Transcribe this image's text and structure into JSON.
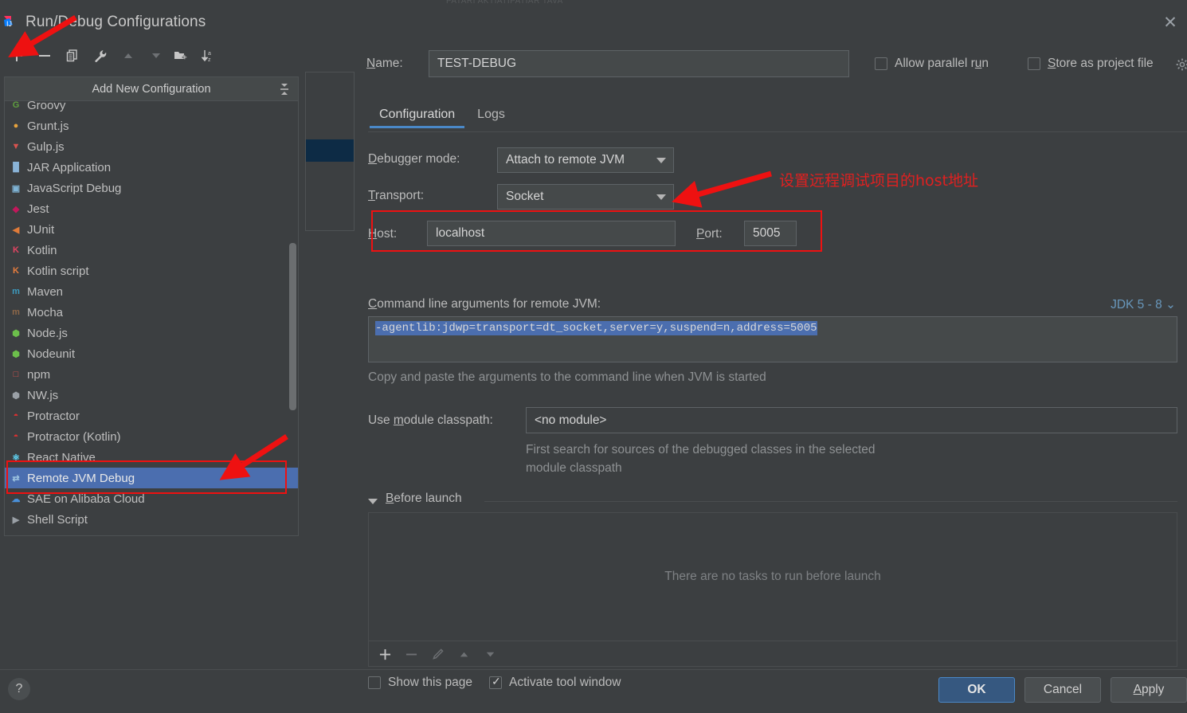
{
  "window": {
    "title": "Run/Debug Configurations",
    "app_icon": "intellij-icon",
    "close_icon": "close-icon"
  },
  "toolbar": {
    "buttons": [
      {
        "name": "add-configuration-button",
        "glyph": "+",
        "enabled": true
      },
      {
        "name": "remove-configuration-button",
        "glyph": "−",
        "enabled": true
      },
      {
        "name": "copy-configuration-button",
        "glyph": "copy-icon",
        "enabled": true
      },
      {
        "name": "edit-templates-button",
        "glyph": "wrench-icon",
        "enabled": true
      },
      {
        "name": "move-up-button",
        "glyph": "triangle-up-icon",
        "enabled": false
      },
      {
        "name": "move-down-button",
        "glyph": "triangle-down-icon",
        "enabled": false
      },
      {
        "name": "new-folder-button",
        "glyph": "folder-add-icon",
        "enabled": true
      },
      {
        "name": "sort-alphabetically-button",
        "glyph": "sort-az-icon",
        "enabled": true
      }
    ]
  },
  "left_panel": {
    "header": "Add New Configuration",
    "collapse_icon": "collapse-all-icon",
    "items": [
      {
        "label": "Groovy",
        "icon": "groovy-icon",
        "icon_text": "G",
        "icon_color": "#5f9e3f",
        "selected": false,
        "clipped": true
      },
      {
        "label": "Grunt.js",
        "icon": "grunt-icon",
        "icon_text": "●",
        "icon_color": "#e8a33d",
        "selected": false
      },
      {
        "label": "Gulp.js",
        "icon": "gulp-icon",
        "icon_text": "▼",
        "icon_color": "#d9534f",
        "selected": false
      },
      {
        "label": "JAR Application",
        "icon": "jar-icon",
        "icon_text": "█",
        "icon_color": "#8ab4d8",
        "selected": false
      },
      {
        "label": "JavaScript Debug",
        "icon": "javascript-debug-icon",
        "icon_text": "▣",
        "icon_color": "#7fb3d5",
        "selected": false
      },
      {
        "label": "Jest",
        "icon": "jest-icon",
        "icon_text": "◆",
        "icon_color": "#c2185b",
        "selected": false
      },
      {
        "label": "JUnit",
        "icon": "junit-icon",
        "icon_text": "◀",
        "icon_color": "#e07b39",
        "selected": false
      },
      {
        "label": "Kotlin",
        "icon": "kotlin-icon",
        "icon_text": "K",
        "icon_color": "#e24462",
        "selected": false
      },
      {
        "label": "Kotlin script",
        "icon": "kotlin-script-icon",
        "icon_text": "K",
        "icon_color": "#e87d3e",
        "selected": false
      },
      {
        "label": "Maven",
        "icon": "maven-icon",
        "icon_text": "m",
        "icon_color": "#3d9bbf",
        "selected": false
      },
      {
        "label": "Mocha",
        "icon": "mocha-icon",
        "icon_text": "m",
        "icon_color": "#8d6748",
        "selected": false
      },
      {
        "label": "Node.js",
        "icon": "nodejs-icon",
        "icon_text": "⬢",
        "icon_color": "#6cbf4b",
        "selected": false
      },
      {
        "label": "Nodeunit",
        "icon": "nodeunit-icon",
        "icon_text": "⬢",
        "icon_color": "#6cbf4b",
        "selected": false
      },
      {
        "label": "npm",
        "icon": "npm-icon",
        "icon_text": "□",
        "icon_color": "#d9534f",
        "selected": false
      },
      {
        "label": "NW.js",
        "icon": "nwjs-icon",
        "icon_text": "⬢",
        "icon_color": "#9aa0a6",
        "selected": false
      },
      {
        "label": "Protractor",
        "icon": "protractor-icon",
        "icon_text": "◓",
        "icon_color": "#e03030",
        "selected": false
      },
      {
        "label": "Protractor (Kotlin)",
        "icon": "protractor-kotlin-icon",
        "icon_text": "◓",
        "icon_color": "#e03030",
        "selected": false
      },
      {
        "label": "React Native",
        "icon": "react-native-icon",
        "icon_text": "⚛",
        "icon_color": "#61dafb",
        "selected": false
      },
      {
        "label": "Remote JVM Debug",
        "icon": "remote-jvm-debug-icon",
        "icon_text": "⇄",
        "icon_color": "#9cc3e0",
        "selected": true
      },
      {
        "label": "SAE on Alibaba Cloud",
        "icon": "alibaba-cloud-icon",
        "icon_text": "☁",
        "icon_color": "#4a90d9",
        "selected": false
      },
      {
        "label": "Shell Script",
        "icon": "shell-script-icon",
        "icon_text": "▶",
        "icon_color": "#9aa0a6",
        "selected": false
      }
    ]
  },
  "header": {
    "name_label": "Name:",
    "name_label_mnemonic": "N",
    "name_value": "TEST-DEBUG",
    "allow_parallel_run": {
      "label": "Allow parallel run",
      "mnemonic": "u",
      "checked": false
    },
    "store_as_project_file": {
      "label": "Store as project file",
      "mnemonic": "S",
      "checked": false
    },
    "gear_icon": "gear-icon"
  },
  "tabs": [
    {
      "label": "Configuration",
      "active": true
    },
    {
      "label": "Logs",
      "active": false
    }
  ],
  "form": {
    "debugger_mode": {
      "label": "Debugger mode:",
      "mnemonic": "D",
      "value": "Attach to remote JVM"
    },
    "transport": {
      "label": "Transport:",
      "mnemonic": "T",
      "value": "Socket"
    },
    "host": {
      "label": "Host:",
      "mnemonic": "H",
      "value": "localhost"
    },
    "port": {
      "label": "Port:",
      "mnemonic": "P",
      "value": "5005"
    },
    "command_line_label": "Command line arguments for remote JVM:",
    "command_line_mnemonic": "C",
    "jdk_selector": "JDK 5 - 8",
    "command_line_value": "-agentlib:jdwp=transport=dt_socket,server=y,suspend=n,address=5005",
    "copy_hint": "Copy and paste the arguments to the command line when JVM is started",
    "module_classpath": {
      "label": "Use module classpath:",
      "mnemonic": "m",
      "value": "<no module>"
    },
    "module_desc_line1": "First search for sources of the debugged classes in the selected",
    "module_desc_line2": "module classpath"
  },
  "before_launch": {
    "title": "Before launch",
    "mnemonic": "B",
    "empty_text": "There are no tasks to run before launch",
    "toolbar": [
      {
        "name": "add-task-button",
        "glyph": "+",
        "enabled": true
      },
      {
        "name": "remove-task-button",
        "glyph": "−",
        "enabled": false
      },
      {
        "name": "edit-task-button",
        "glyph": "pencil-icon",
        "enabled": false
      },
      {
        "name": "move-task-up-button",
        "glyph": "triangle-up-icon",
        "enabled": false
      },
      {
        "name": "move-task-down-button",
        "glyph": "triangle-down-icon",
        "enabled": false
      }
    ],
    "show_this_page": {
      "label": "Show this page",
      "checked": false
    },
    "activate_tool_window": {
      "label": "Activate tool window",
      "checked": true
    }
  },
  "footer": {
    "help_glyph": "?",
    "ok": "OK",
    "cancel": "Cancel",
    "apply": "Apply",
    "apply_mnemonic": "A"
  },
  "annotations": {
    "note_text": "设置远程调试项目的host地址",
    "color": "#ee1111"
  }
}
